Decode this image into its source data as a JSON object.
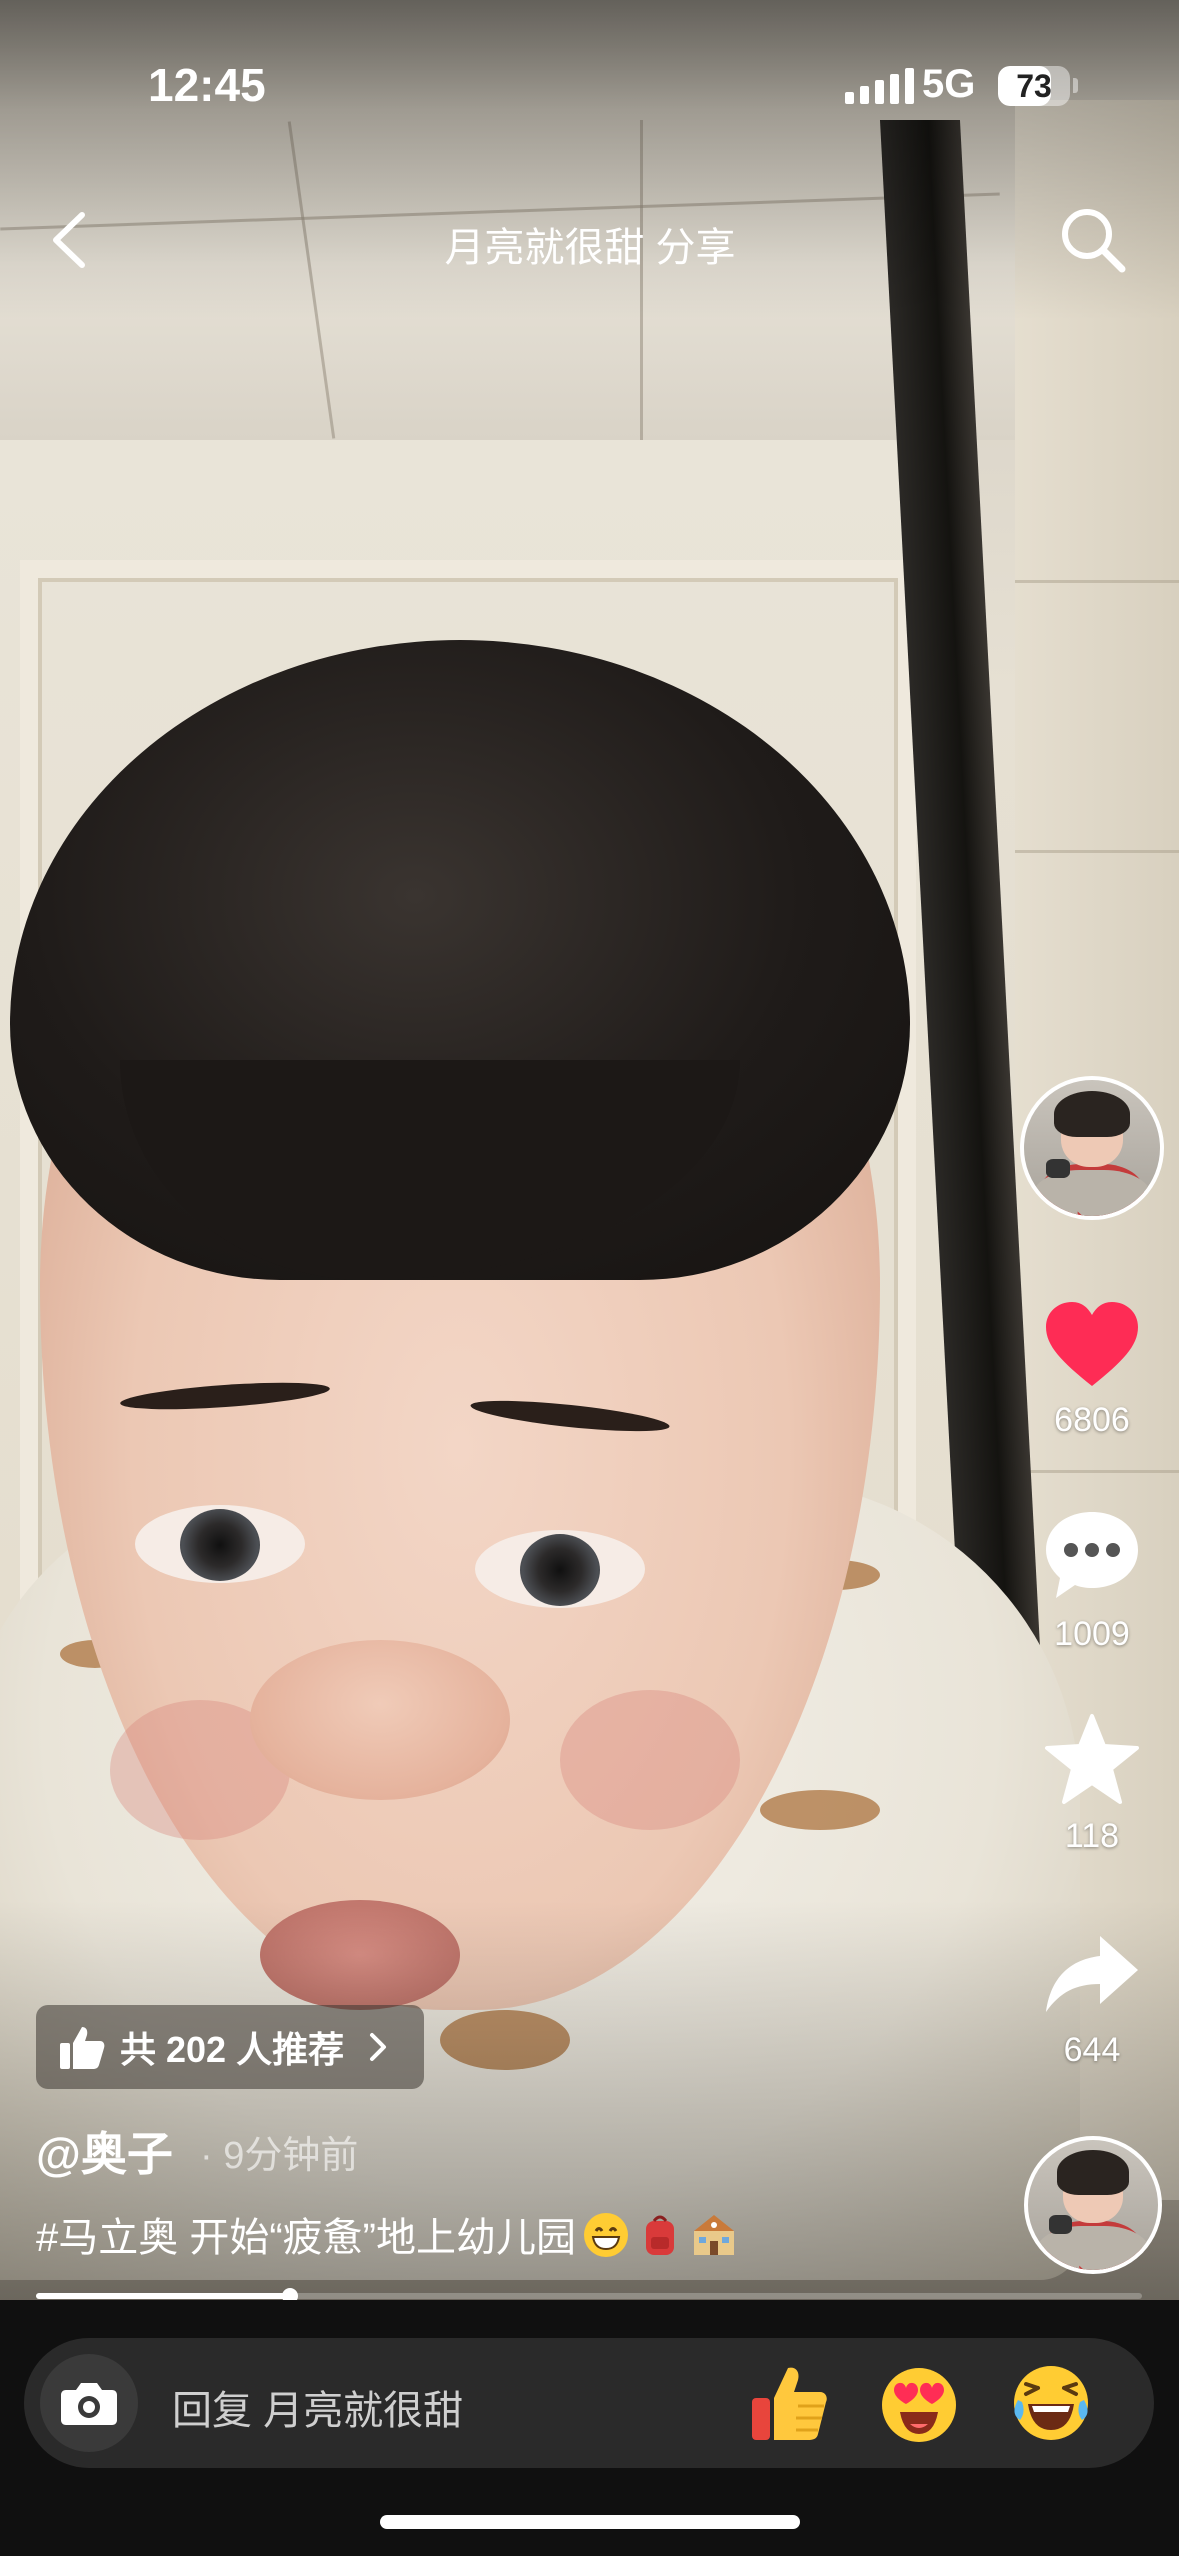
{
  "status_bar": {
    "time": "12:45",
    "network": "5G",
    "battery": "73",
    "battery_level_percent": 73
  },
  "nav": {
    "title": "月亮就很甜 分享",
    "back_icon": "chevron-left-icon",
    "search_icon": "search-icon"
  },
  "actions": {
    "likes": "6806",
    "comments": "1009",
    "favorites": "118",
    "shares": "644",
    "like_color": "#fe2c55"
  },
  "post": {
    "recommend": "共 202 人推荐",
    "author": "@奥子",
    "time_ago": "· 9分钟前",
    "caption": "#马立奥 开始“疲惫”地上幼儿园"
  },
  "progress_percent": 23,
  "reply": {
    "placeholder": "回复 月亮就很甜"
  }
}
